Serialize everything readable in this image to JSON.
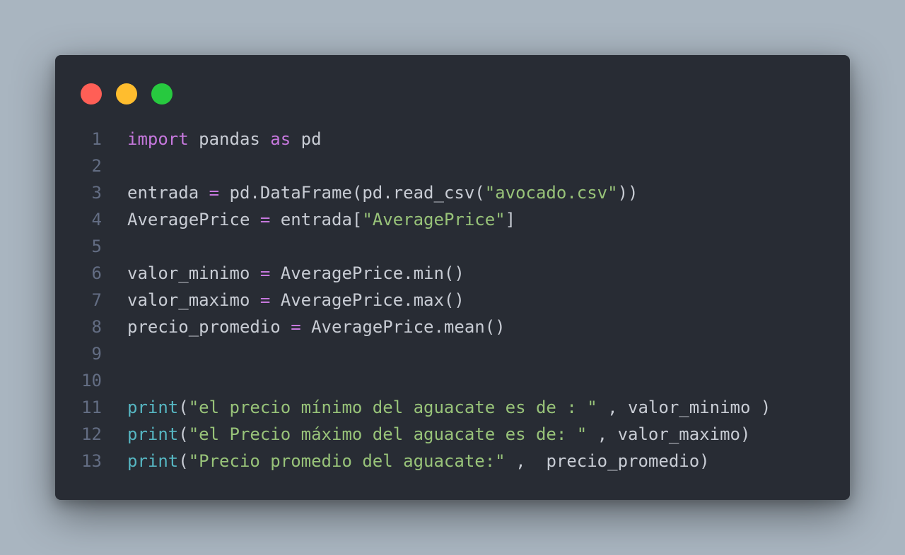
{
  "window": {
    "controls": [
      {
        "name": "close",
        "color": "#ff5f56"
      },
      {
        "name": "minimize",
        "color": "#ffbd2e"
      },
      {
        "name": "maximize",
        "color": "#27c93f"
      }
    ]
  },
  "code": {
    "lines": [
      {
        "n": "1",
        "tokens": [
          [
            "kw",
            "import"
          ],
          [
            "pl",
            " pandas "
          ],
          [
            "kw",
            "as"
          ],
          [
            "pl",
            " pd"
          ]
        ]
      },
      {
        "n": "2",
        "tokens": []
      },
      {
        "n": "3",
        "tokens": [
          [
            "pl",
            "entrada "
          ],
          [
            "op",
            "="
          ],
          [
            "pl",
            " pd.DataFrame(pd.read_csv("
          ],
          [
            "str",
            "\"avocado.csv\""
          ],
          [
            "pl",
            "))"
          ]
        ]
      },
      {
        "n": "4",
        "tokens": [
          [
            "pl",
            "AveragePrice "
          ],
          [
            "op",
            "="
          ],
          [
            "pl",
            " entrada["
          ],
          [
            "str",
            "\"AveragePrice\""
          ],
          [
            "pl",
            "]"
          ]
        ]
      },
      {
        "n": "5",
        "tokens": []
      },
      {
        "n": "6",
        "tokens": [
          [
            "pl",
            "valor_minimo "
          ],
          [
            "op",
            "="
          ],
          [
            "pl",
            " AveragePrice.min()"
          ]
        ]
      },
      {
        "n": "7",
        "tokens": [
          [
            "pl",
            "valor_maximo "
          ],
          [
            "op",
            "="
          ],
          [
            "pl",
            " AveragePrice.max()"
          ]
        ]
      },
      {
        "n": "8",
        "tokens": [
          [
            "pl",
            "precio_promedio "
          ],
          [
            "op",
            "="
          ],
          [
            "pl",
            " AveragePrice.mean()"
          ]
        ]
      },
      {
        "n": "9",
        "tokens": []
      },
      {
        "n": "10",
        "tokens": []
      },
      {
        "n": "11",
        "tokens": [
          [
            "fn",
            "print"
          ],
          [
            "pl",
            "("
          ],
          [
            "str",
            "\"el precio mínimo del aguacate es de : \""
          ],
          [
            "pl",
            " , valor_minimo )"
          ]
        ]
      },
      {
        "n": "12",
        "tokens": [
          [
            "fn",
            "print"
          ],
          [
            "pl",
            "("
          ],
          [
            "str",
            "\"el Precio máximo del aguacate es de: \""
          ],
          [
            "pl",
            " , valor_maximo)"
          ]
        ]
      },
      {
        "n": "13",
        "tokens": [
          [
            "fn",
            "print"
          ],
          [
            "pl",
            "("
          ],
          [
            "str",
            "\"Precio promedio del aguacate:\""
          ],
          [
            "pl",
            " ,  precio_promedio)"
          ]
        ]
      }
    ]
  }
}
